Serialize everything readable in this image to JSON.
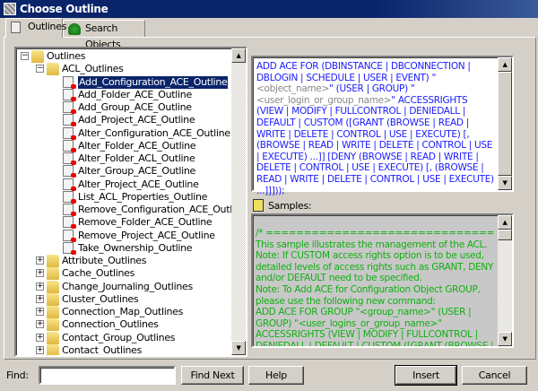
{
  "window": {
    "title": "Choose Outline"
  },
  "tabs": [
    {
      "label": "Outlines",
      "icon": "outline-doc-icon",
      "selected": true
    },
    {
      "label": "Search Objects",
      "icon": "search-objects-icon",
      "selected": false
    }
  ],
  "tree": {
    "root": "Outlines",
    "expanded_folder": "ACL_Outlines",
    "selected": "Add_Configuration_ACE_Outline",
    "acl_items": [
      "Add_Configuration_ACE_Outline",
      "Add_Folder_ACE_Outline",
      "Add_Group_ACE_Outline",
      "Add_Project_ACE_Outline",
      "Alter_Configuration_ACE_Outline",
      "Alter_Folder_ACE_Outline",
      "Alter_Folder_ACL_Outline",
      "Alter_Group_ACE_Outline",
      "Alter_Project_ACE_Outline",
      "List_ACL_Properties_Outline",
      "Remove_Configuration_ACE_Outline",
      "Remove_Folder_ACE_Outline",
      "Remove_Project_ACE_Outline",
      "Take_Ownership_Outline"
    ],
    "folders": [
      "Attribute_Outlines",
      "Cache_Outlines",
      "Change_Journaling_Outlines",
      "Cluster_Outlines",
      "Connection_Map_Outlines",
      "Connection_Outlines",
      "Contact_Group_Outlines",
      "Contact_Outlines"
    ]
  },
  "syntax": {
    "part1": "ADD ACE FOR (DBINSTANCE | DBCONNECTION | DBLOGIN | SCHEDULE | USER | EVENT) \"",
    "ph1": "<object_name>",
    "part2": "\" (USER | GROUP) \"",
    "ph2": "<user_login_or_group_name>",
    "part3": "\" ACCESSRIGHTS (VIEW | MODIFY | FULLCONTROL | DENIEDALL | DEFAULT | CUSTOM ([GRANT (BROWSE | READ | WRITE | DELETE | CONTROL | USE | EXECUTE) [, (BROWSE | READ | WRITE | DELETE | CONTROL | USE | EXECUTE) ...]] [DENY (BROWSE | READ | WRITE | DELETE | CONTROL | USE | EXECUTE) [, (BROWSE | READ | WRITE | DELETE | CONTROL | USE | EXECUTE) ...]]]));"
  },
  "samples": {
    "label": "Samples:",
    "lines": [
      "/* ====================================",
      "This sample illustrates the management of the ACL.",
      "Note: If CUSTOM access rights option is to be used, detailed levels of access rights such as GRANT, DENY and/or DEFAULT need to be specified.",
      "Note: To Add ACE for Configuration Object GROUP, please use the following new command:",
      "ADD ACE FOR GROUP \"<group_name>\" (USER | GROUP) \"<user_logins_or_group_name>\" ACCESSRIGHTS (VIEW | MODIFY | FULLCONTROL | DENIEDALL | DEFAULT | CUSTOM ([GRANT (BROWSE | READ | WRITE | DELETE | CONTROL |"
    ]
  },
  "footer": {
    "find_label": "Find:",
    "find_value": "",
    "find_next": "Find Next",
    "help": "Help",
    "insert": "Insert",
    "cancel": "Cancel"
  },
  "colors": {
    "title_bar": "#0a246a",
    "syntax_text": "#1a1aff",
    "sample_text": "#10b010",
    "placeholder": "#888888"
  }
}
